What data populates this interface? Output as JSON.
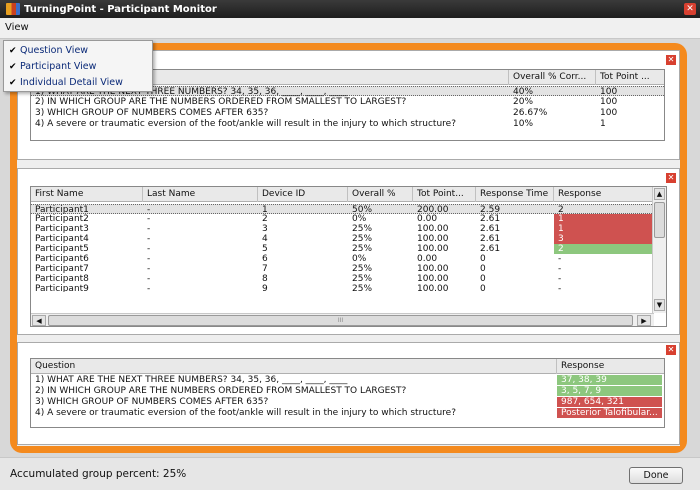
{
  "window": {
    "title": "TurningPoint - Participant Monitor",
    "close": "✕"
  },
  "menu": {
    "view_label": "View",
    "items": [
      {
        "label": "Question View",
        "check": "✔"
      },
      {
        "label": "Participant View",
        "check": "✔"
      },
      {
        "label": "Individual Detail View",
        "check": "✔"
      }
    ]
  },
  "panel_close": "✕",
  "question_view": {
    "columns": [
      "Overall % Corr...",
      "Tot Point ..."
    ],
    "rows": [
      {
        "q": "1) WHAT ARE THE NEXT THREE NUMBERS?  34, 35, 36, ____, ____, ____",
        "pct": "40%",
        "pts": "100"
      },
      {
        "q": "2) IN WHICH GROUP ARE THE NUMBERS ORDERED FROM SMALLEST TO LARGEST?",
        "pct": "20%",
        "pts": "100"
      },
      {
        "q": "3) WHICH GROUP OF NUMBERS COMES AFTER 635?",
        "pct": "26.67%",
        "pts": "100"
      },
      {
        "q": "4) A severe or traumatic eversion of the foot/ankle will result in the injury to which structure?",
        "pct": "10%",
        "pts": "1"
      }
    ]
  },
  "participant_view": {
    "columns": [
      "First Name",
      "Last Name",
      "Device ID",
      "Overall %",
      "Tot Point...",
      "Response Time",
      "Response"
    ],
    "rows": [
      {
        "first": "Participant1",
        "last": "-",
        "device": "1",
        "overall": "50%",
        "points": "200.00",
        "time": "2.59",
        "response": "2",
        "status": "selected"
      },
      {
        "first": "Participant2",
        "last": "-",
        "device": "2",
        "overall": "0%",
        "points": "0.00",
        "time": "2.61",
        "response": "1",
        "status": "incorrect"
      },
      {
        "first": "Participant3",
        "last": "-",
        "device": "3",
        "overall": "25%",
        "points": "100.00",
        "time": "2.61",
        "response": "1",
        "status": "incorrect"
      },
      {
        "first": "Participant4",
        "last": "-",
        "device": "4",
        "overall": "25%",
        "points": "100.00",
        "time": "2.61",
        "response": "3",
        "status": "incorrect"
      },
      {
        "first": "Participant5",
        "last": "-",
        "device": "5",
        "overall": "25%",
        "points": "100.00",
        "time": "2.61",
        "response": "2",
        "status": "correct"
      },
      {
        "first": "Participant6",
        "last": "-",
        "device": "6",
        "overall": "0%",
        "points": "0.00",
        "time": "0",
        "response": "-",
        "status": "none"
      },
      {
        "first": "Participant7",
        "last": "-",
        "device": "7",
        "overall": "25%",
        "points": "100.00",
        "time": "0",
        "response": "-",
        "status": "none"
      },
      {
        "first": "Participant8",
        "last": "-",
        "device": "8",
        "overall": "25%",
        "points": "100.00",
        "time": "0",
        "response": "-",
        "status": "none"
      },
      {
        "first": "Participant9",
        "last": "-",
        "device": "9",
        "overall": "25%",
        "points": "100.00",
        "time": "0",
        "response": "-",
        "status": "none"
      }
    ],
    "scroll": {
      "up": "▲",
      "down": "▼",
      "left": "◀",
      "right": "▶",
      "grip": "III"
    }
  },
  "detail_view": {
    "columns": [
      "Question",
      "Response"
    ],
    "rows": [
      {
        "q": "1) WHAT ARE THE NEXT THREE NUMBERS?  34, 35, 36, ____, ____, ____",
        "response": "37, 38, 39",
        "status": "correct"
      },
      {
        "q": "2) IN WHICH GROUP ARE THE NUMBERS ORDERED FROM SMALLEST TO LARGEST?",
        "response": "3, 5, 7, 9",
        "status": "correct"
      },
      {
        "q": "3) WHICH GROUP OF NUMBERS COMES AFTER 635?",
        "response": "987, 654, 321",
        "status": "incorrect"
      },
      {
        "q": "4) A severe or traumatic eversion of the foot/ankle will result in the injury to which structure?",
        "response": "Posterior Talofibular...",
        "status": "incorrect"
      }
    ]
  },
  "status_bar": {
    "text": "Accumulated group percent: 25%",
    "done_label": "Done"
  },
  "colors": {
    "accent_frame": "#f48a1e",
    "incorrect": "#cf5250",
    "correct": "#8dc77e",
    "close": "#d84030"
  }
}
